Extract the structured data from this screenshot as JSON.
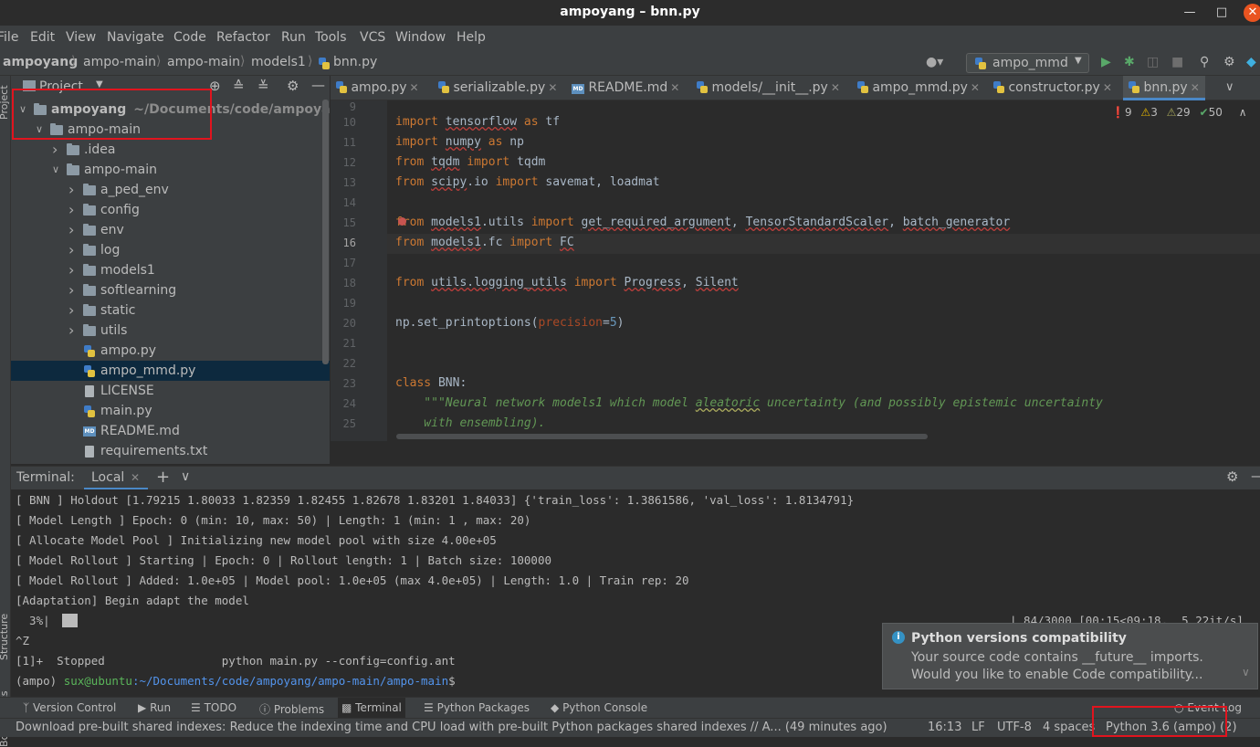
{
  "window": {
    "title": "ampoyang – bnn.py"
  },
  "menu": [
    "File",
    "Edit",
    "View",
    "Navigate",
    "Code",
    "Refactor",
    "Run",
    "Tools",
    "VCS",
    "Window",
    "Help"
  ],
  "breadcrumb": [
    "ampoyang",
    "ampo-main",
    "ampo-main",
    "models1",
    "bnn.py"
  ],
  "run_config": {
    "label": "ampo_mmd"
  },
  "project_panel": {
    "title": "Project",
    "stripe_label": "Project",
    "tree": [
      {
        "label": "ampoyang",
        "suffix": "~/Documents/code/ampoyang",
        "type": "folder",
        "depth": 0,
        "expanded": true
      },
      {
        "label": "ampo-main",
        "type": "folder",
        "depth": 1,
        "expanded": true
      },
      {
        "label": ".idea",
        "type": "folder",
        "depth": 2,
        "expanded": false
      },
      {
        "label": "ampo-main",
        "type": "folder",
        "depth": 2,
        "expanded": true
      },
      {
        "label": "a_ped_env",
        "type": "folder",
        "depth": 3,
        "expanded": false
      },
      {
        "label": "config",
        "type": "folder",
        "depth": 3,
        "expanded": false
      },
      {
        "label": "env",
        "type": "folder",
        "depth": 3,
        "expanded": false
      },
      {
        "label": "log",
        "type": "folder",
        "depth": 3,
        "expanded": false
      },
      {
        "label": "models1",
        "type": "folder",
        "depth": 3,
        "expanded": false
      },
      {
        "label": "softlearning",
        "type": "folder",
        "depth": 3,
        "expanded": false
      },
      {
        "label": "static",
        "type": "folder",
        "depth": 3,
        "expanded": false
      },
      {
        "label": "utils",
        "type": "folder",
        "depth": 3,
        "expanded": false
      },
      {
        "label": "ampo.py",
        "type": "py",
        "depth": 3
      },
      {
        "label": "ampo_mmd.py",
        "type": "py",
        "depth": 3,
        "selected": true
      },
      {
        "label": "LICENSE",
        "type": "txt",
        "depth": 3
      },
      {
        "label": "main.py",
        "type": "py",
        "depth": 3
      },
      {
        "label": "README.md",
        "type": "md",
        "depth": 3
      },
      {
        "label": "requirements.txt",
        "type": "txt",
        "depth": 3
      }
    ]
  },
  "tabs": [
    {
      "label": "ampo.py",
      "icon": "python-file-icon"
    },
    {
      "label": "serializable.py",
      "icon": "python-file-icon"
    },
    {
      "label": "README.md",
      "icon": "markdown-file-icon"
    },
    {
      "label": "models/__init__.py",
      "icon": "python-file-icon"
    },
    {
      "label": "ampo_mmd.py",
      "icon": "python-file-icon"
    },
    {
      "label": "constructor.py",
      "icon": "python-file-icon"
    },
    {
      "label": "bnn.py",
      "icon": "python-file-icon",
      "active": true
    }
  ],
  "inspections": {
    "errors": "9",
    "warnings": "3",
    "weak_warnings": "29",
    "ok": "50"
  },
  "editor": {
    "current_line": "16",
    "lines": [
      {
        "n": "10",
        "t": "import tensorflow as tf"
      },
      {
        "n": "11",
        "t": "import numpy as np"
      },
      {
        "n": "12",
        "t": "from tqdm import tqdm"
      },
      {
        "n": "13",
        "t": "from scipy.io import savemat, loadmat"
      },
      {
        "n": "14",
        "t": ""
      },
      {
        "n": "15",
        "t": "from models1.utils import get_required_argument, TensorStandardScaler, batch_generator"
      },
      {
        "n": "16",
        "t": "from models1.fc import FC"
      },
      {
        "n": "17",
        "t": ""
      },
      {
        "n": "18",
        "t": "from utils.logging_utils import Progress, Silent"
      },
      {
        "n": "19",
        "t": ""
      },
      {
        "n": "20",
        "t": "np.set_printoptions(precision=5)"
      },
      {
        "n": "21",
        "t": ""
      },
      {
        "n": "22",
        "t": ""
      },
      {
        "n": "23",
        "t": "class BNN:"
      },
      {
        "n": "24",
        "t": "    \"\"\"Neural network models1 which model aleatoric uncertainty (and possibly epistemic uncertainty"
      },
      {
        "n": "25",
        "t": "    with ensembling)."
      }
    ]
  },
  "terminal": {
    "title": "Terminal:",
    "tab": "Local",
    "lines": [
      "[ BNN ] Holdout [1.79215 1.80033 1.82359 1.82455 1.82678 1.83201 1.84033] {'train_loss': 1.3861586, 'val_loss': 1.8134791}",
      "[ Model Length ] Epoch: 0 (min: 10, max: 50) | Length: 1 (min: 1 , max: 20)",
      "[ Allocate Model Pool ] Initializing new model pool with size 4.00e+05",
      "[ Model Rollout ] Starting | Epoch: 0 | Rollout length: 1 | Batch size: 100000",
      "[ Model Rollout ] Added: 1.0e+05 | Model pool: 1.0e+05 (max 4.0e+05) | Length: 1.0 | Train rep: 20",
      "[Adaptation] Begin adapt the model"
    ],
    "progress_label": "  3%|",
    "progress_fraction": 0.03,
    "progress_right": "| 84/3000 [00:15<09:18,  5.22it/s]",
    "ctrl_z": "^Z",
    "stopped": "[1]+  Stopped                 python main.py --config=config.ant",
    "prompt_env": "(ampo) ",
    "prompt_user": "sux@ubuntu",
    "prompt_path": ":~/Documents/code/ampoyang/ampo-main/ampo-main",
    "prompt_end": "$"
  },
  "notification": {
    "title": "Python versions compatibility",
    "line1": "Your source code contains __future__ imports.",
    "line2": "Would you like to enable Code compatibility..."
  },
  "tool_windows": {
    "version_control": "Version Control",
    "run": "Run",
    "todo": "TODO",
    "problems": "Problems",
    "terminal": "Terminal",
    "python_packages": "Python Packages",
    "python_console": "Python Console",
    "event_log": "Event Log"
  },
  "left_stripe": {
    "structure": "Structure",
    "bookmarks": "Bookmarks"
  },
  "statusbar": {
    "message": "Download pre-built shared indexes: Reduce the indexing time and CPU load with pre-built Python packages shared indexes // A... (49 minutes ago)",
    "position": "16:13",
    "line_sep": "LF",
    "encoding": "UTF-8",
    "indent": "4 spaces",
    "interpreter": "Python 3.6 (ampo) (2)"
  },
  "colors": {
    "accent": "#4a88c7",
    "highlight_box": "#e1141e",
    "background": "#2b2b2b"
  }
}
